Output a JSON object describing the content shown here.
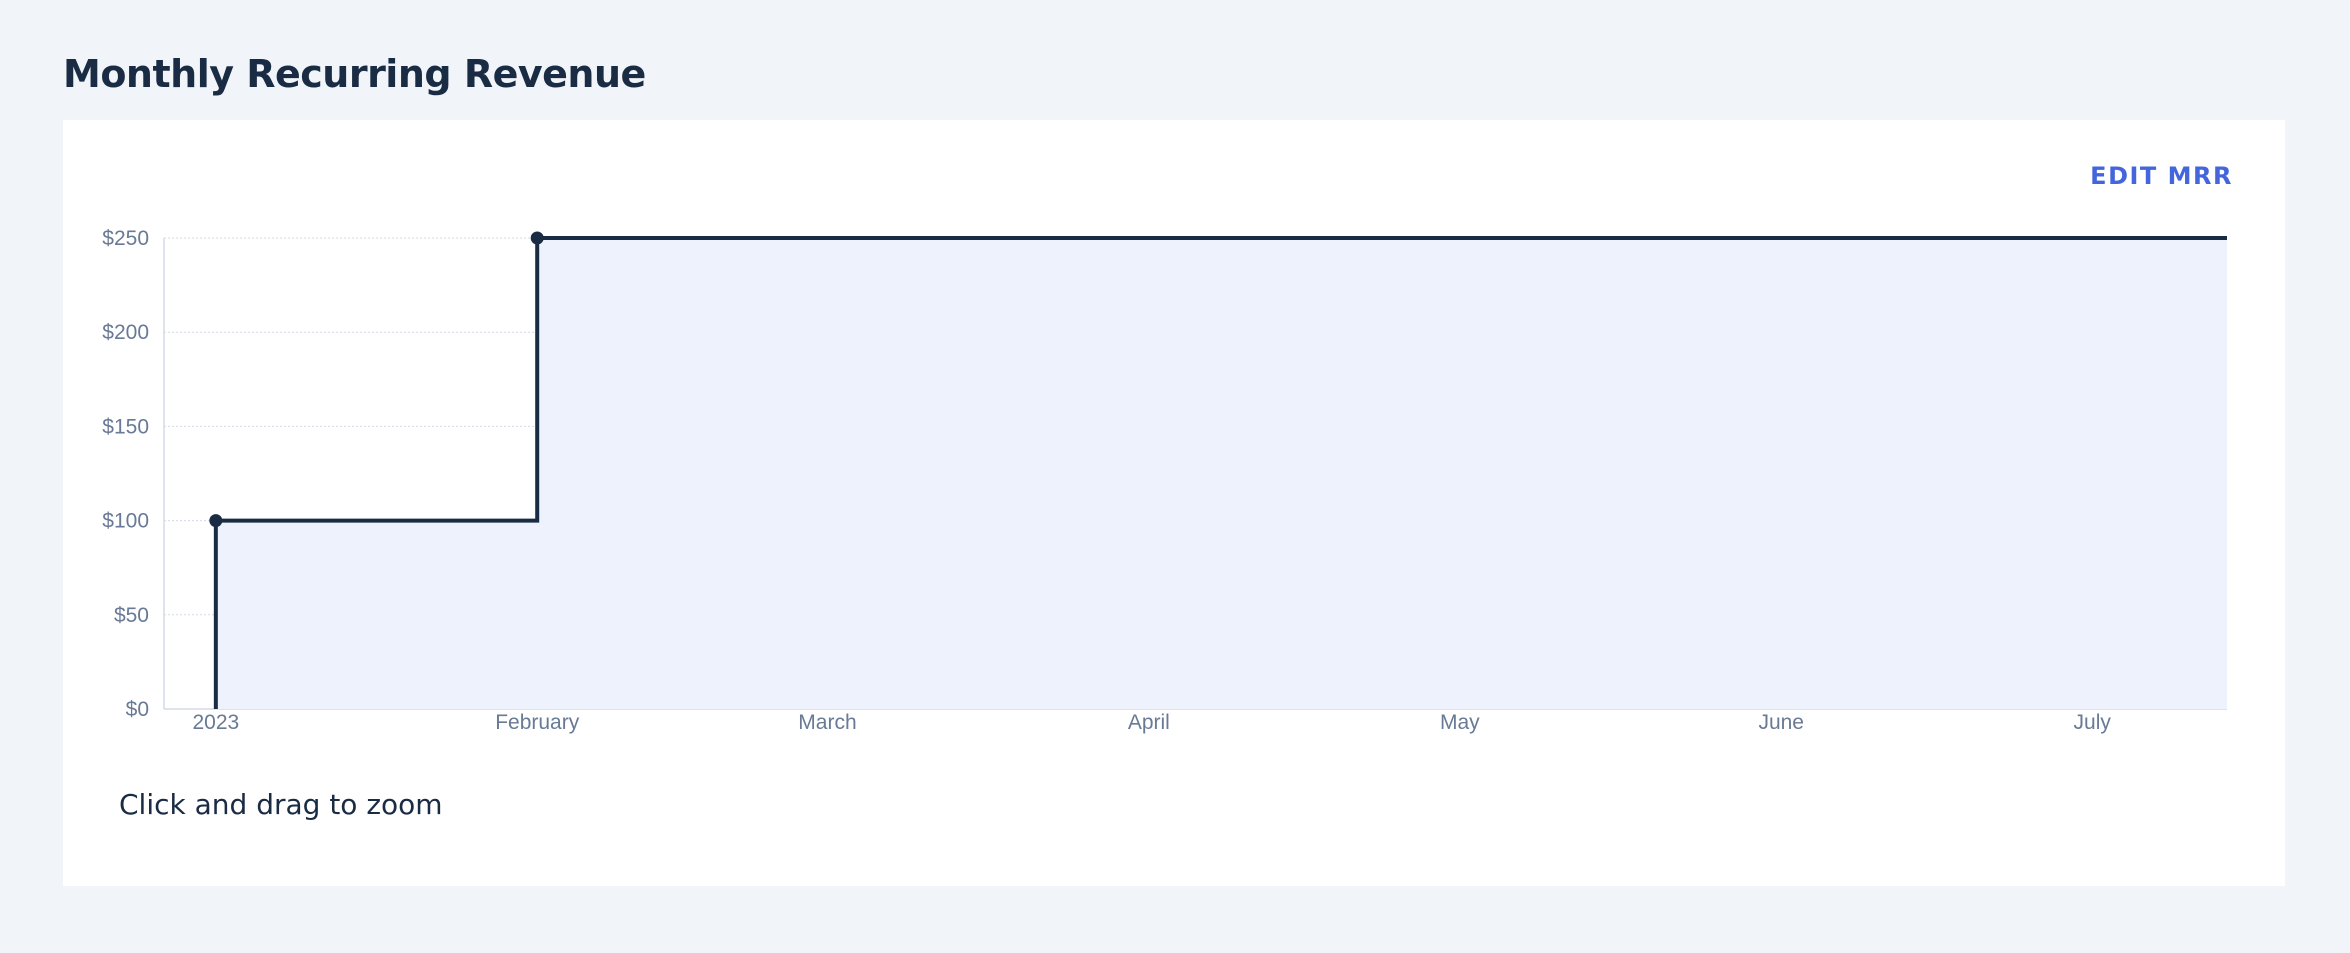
{
  "page": {
    "title": "Monthly Recurring Revenue",
    "edit_button_label": "EDIT MRR",
    "hint": "Click and drag to zoom"
  },
  "colors": {
    "background": "#f1f4f9",
    "card": "#ffffff",
    "line": "#1a2b44",
    "area_fill": "#eef2fc",
    "accent": "#4466dd",
    "grid": "#d4dae6"
  },
  "chart_data": {
    "type": "area",
    "step": true,
    "title": "",
    "xlabel": "",
    "ylabel": "",
    "ylim": [
      0,
      250
    ],
    "xlim": [
      "2022-12-27",
      "2023-07-14"
    ],
    "y_ticks": [
      0,
      50,
      100,
      150,
      200,
      250
    ],
    "y_tick_labels": [
      "$0",
      "$50",
      "$100",
      "$150",
      "$200",
      "$250"
    ],
    "x_ticks": [
      "2023-01-01",
      "2023-02-01",
      "2023-03-01",
      "2023-04-01",
      "2023-05-01",
      "2023-06-01",
      "2023-07-01"
    ],
    "x_tick_labels": [
      "2023",
      "February",
      "March",
      "April",
      "May",
      "June",
      "July"
    ],
    "grid": true,
    "legend": "none",
    "series": [
      {
        "points": [
          {
            "x": "2023-01-01",
            "y": 100
          },
          {
            "x": "2023-02-01",
            "y": 250
          },
          {
            "x": "2023-07-14",
            "y": 250
          }
        ],
        "markers": [
          "2023-01-01",
          "2023-02-01"
        ]
      }
    ]
  }
}
